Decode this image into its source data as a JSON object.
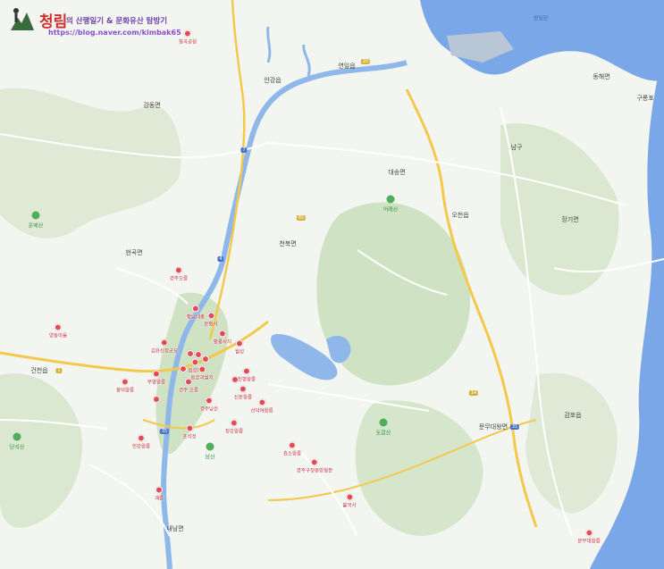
{
  "brand": {
    "title": "청림",
    "subtitle": "의 산행일기 & 문화유산 탐방기",
    "url": "https://blog.naver.com/kimbak65"
  },
  "colors": {
    "river": "#8fb7ea",
    "sea": "#7aa7e8",
    "highway": "#f4c84a",
    "road": "#ffffff",
    "poi": "#e64a55",
    "forest": "#cfe3c4"
  },
  "region_labels": [
    {
      "id": "anggang",
      "text": "안강읍"
    },
    {
      "id": "yeonil",
      "text": "연일읍"
    },
    {
      "id": "daesong",
      "text": "대송면"
    },
    {
      "id": "namgu",
      "text": "남구"
    },
    {
      "id": "donghae",
      "text": "동해면"
    },
    {
      "id": "gureyong",
      "text": "구룡포"
    },
    {
      "id": "ocheon",
      "text": "오천읍"
    },
    {
      "id": "janggi",
      "text": "장기면"
    },
    {
      "id": "cheonbuk",
      "text": "천북면"
    },
    {
      "id": "hyeongok",
      "text": "현곡면"
    },
    {
      "id": "geoncheon",
      "text": "건천읍"
    },
    {
      "id": "gampo",
      "text": "감포읍"
    },
    {
      "id": "munmu",
      "text": "문무대왕면"
    },
    {
      "id": "naenam",
      "text": "내남면"
    },
    {
      "id": "gangdong",
      "text": "강동면"
    }
  ],
  "poi_markers": [
    {
      "id": "p1",
      "text": "칠곡공원"
    },
    {
      "id": "p2",
      "text": "경주오릉"
    },
    {
      "id": "p3",
      "text": "황남대총"
    },
    {
      "id": "p4",
      "text": "분황사"
    },
    {
      "id": "p5",
      "text": "황룡사지"
    },
    {
      "id": "p6",
      "text": "첨성대"
    },
    {
      "id": "p7",
      "text": "동궁과월지"
    },
    {
      "id": "p8",
      "text": "월성"
    },
    {
      "id": "p9",
      "text": "경주남산"
    },
    {
      "id": "p10",
      "text": "포석정"
    },
    {
      "id": "p11",
      "text": "불국사"
    },
    {
      "id": "p12",
      "text": "석굴암"
    },
    {
      "id": "p13",
      "text": "감은사지"
    },
    {
      "id": "p14",
      "text": "문무대왕릉"
    },
    {
      "id": "p15",
      "text": "양동마을"
    },
    {
      "id": "p16",
      "text": "옥산서원"
    },
    {
      "id": "p17",
      "text": "김유신장군묘"
    },
    {
      "id": "p18",
      "text": "무열왕릉"
    },
    {
      "id": "p19",
      "text": "괘릉"
    },
    {
      "id": "p20",
      "text": "진평왕릉"
    },
    {
      "id": "p21",
      "text": "선덕여왕릉"
    },
    {
      "id": "p22",
      "text": "흥덕왕릉"
    },
    {
      "id": "p23",
      "text": "경주 오릉"
    },
    {
      "id": "p24",
      "text": "헌강왕릉"
    },
    {
      "id": "p25",
      "text": "정강왕릉"
    },
    {
      "id": "p26",
      "text": "신문왕릉"
    },
    {
      "id": "p27",
      "text": "효소왕릉"
    },
    {
      "id": "p28",
      "text": "경주구정동방형분"
    },
    {
      "id": "p29",
      "text": "사천왕사지"
    },
    {
      "id": "p30",
      "text": "망덕사지"
    }
  ],
  "mountains": [
    {
      "id": "m1",
      "text": "어래산"
    },
    {
      "id": "m2",
      "text": "운제산"
    },
    {
      "id": "m3",
      "text": "토함산"
    },
    {
      "id": "m4",
      "text": "단석산"
    },
    {
      "id": "m5",
      "text": "남산"
    }
  ],
  "route_badges": [
    {
      "id": "r1",
      "text": "7"
    },
    {
      "id": "r2",
      "text": "20"
    },
    {
      "id": "r3",
      "text": "4"
    },
    {
      "id": "r4",
      "text": "14"
    },
    {
      "id": "r5",
      "text": "31"
    },
    {
      "id": "r6",
      "text": "35"
    },
    {
      "id": "r7",
      "text": "1"
    },
    {
      "id": "r8",
      "text": "65"
    }
  ],
  "sea_labels": [
    {
      "id": "s1",
      "text": "영일만"
    }
  ]
}
